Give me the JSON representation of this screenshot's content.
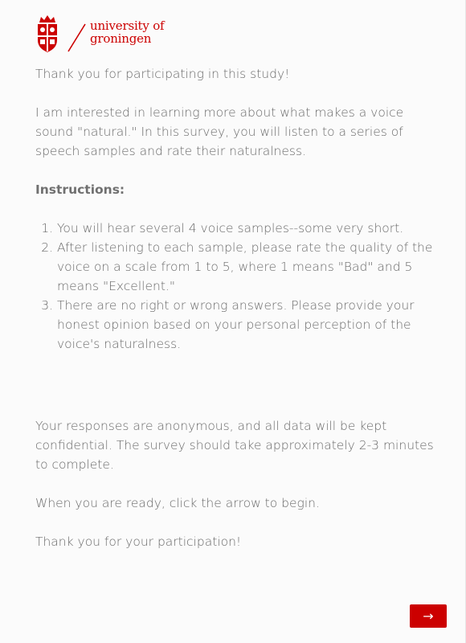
{
  "header": {
    "logo_line1": "university of",
    "logo_line2": "groningen",
    "brand_color": "#cc0000"
  },
  "intro": {
    "thanks": "Thank you for participating in this study!",
    "description": "I am interested in learning more about what makes a voice sound \"natural.\" In this survey, you will listen to a series of speech samples and rate their naturalness."
  },
  "instructions": {
    "heading": "Instructions:",
    "items": [
      "You will hear several 4 voice samples--some very short.",
      "After listening to each sample, please rate the quality of the voice on a scale from 1 to 5, where 1 means \"Bad\" and 5 means \"Excellent.\"",
      "There are no right or wrong answers. Please provide your honest opinion based on your personal perception of the voice's naturalness."
    ]
  },
  "footer_text": {
    "anonymity": "Your responses are anonymous, and all data will be kept confidential. The survey should take approximately 2-3 minutes to complete.",
    "ready": "When you are ready, click the arrow to begin.",
    "closing": "Thank you for your participation!"
  },
  "navigation": {
    "next_label": "→",
    "next_icon": "arrow-right-icon"
  }
}
